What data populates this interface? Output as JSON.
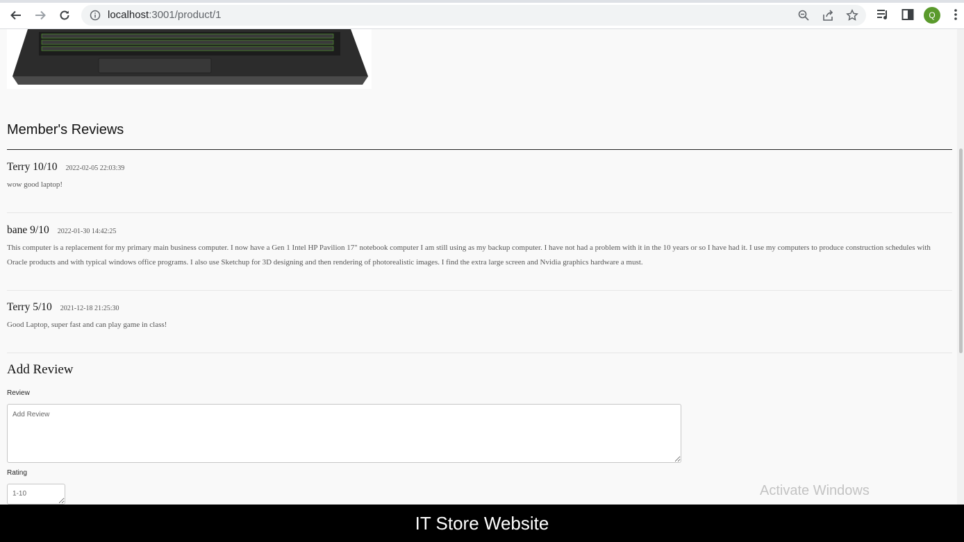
{
  "browser": {
    "url_host": "localhost",
    "url_rest": ":3001/product/1",
    "profile_initial": "Q"
  },
  "reviews_section": {
    "title": "Member's Reviews",
    "reviews": [
      {
        "author_rating": "Terry 10/10",
        "date": "2022-02-05 22:03:39",
        "text": "wow good laptop!"
      },
      {
        "author_rating": "bane 9/10",
        "date": "2022-01-30 14:42:25",
        "text": "This computer is a replacement for my primary main business computer. I now have a Gen 1 Intel HP Pavilion 17\" notebook computer I am still using as my backup computer. I have not had a problem with it in the 10 years or so I have had it. I use my computers to produce construction schedules with Oracle products and with typical windows office programs. I also use Sketchup for 3D designing and then rendering of photorealistic images. I find the extra large screen and Nvidia graphics hardware a must."
      },
      {
        "author_rating": "Terry 5/10",
        "date": "2021-12-18 21:25:30",
        "text": "Good Laptop, super fast and can play game in class!"
      }
    ]
  },
  "add_review": {
    "title": "Add Review",
    "review_label": "Review",
    "review_placeholder": "Add Review",
    "rating_label": "Rating",
    "rating_placeholder": "1-10"
  },
  "watermark": "Activate Windows",
  "footer": "IT Store Website"
}
